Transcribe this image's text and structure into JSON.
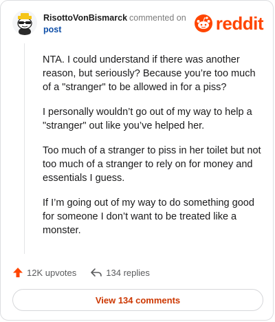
{
  "header": {
    "username": "RisottoVonBismarck",
    "commented_text": "commented on",
    "post_link": "post",
    "brand": "reddit",
    "brand_color": "#ff4500",
    "avatar_icon": "snoo-avatar-with-sunglasses-icon"
  },
  "comment": {
    "paragraphs": [
      "NTA. I could understand if there was another reason, but seriously? Because you’re too much of a \"stranger\" to be allowed in for a piss?",
      "I personally wouldn’t go out of my way to help a \"stranger\" out like you’ve helped her.",
      "Too much of a stranger to piss in her toilet but not too much of a stranger to rely on for money and essentials I guess.",
      "If I’m going out of my way to do something good for someone I don’t want to be treated like a monster."
    ]
  },
  "actions": {
    "upvotes": "12K upvotes",
    "replies": "134 replies",
    "upvote_icon": "upvote-arrow-icon",
    "reply_icon": "reply-arrow-icon"
  },
  "footer": {
    "view_comments": "View 134 comments",
    "accent_color": "#cc3700"
  }
}
